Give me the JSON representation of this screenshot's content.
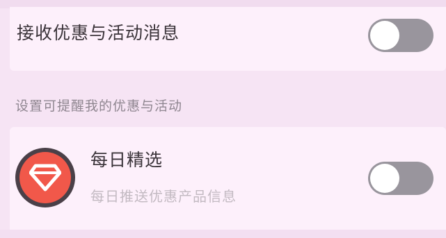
{
  "promo": {
    "receive_label": "接收优惠与活动消息",
    "receive_toggle": "off",
    "caption": "设置可提醒我的优惠与活动"
  },
  "daily_pick": {
    "title": "每日精选",
    "subtitle": "每日推送优惠产品信息",
    "icon": "diamond-icon",
    "toggle": "off"
  },
  "colors": {
    "background": "#f6e4f4",
    "card": "#fdf0fb",
    "toggle_off": "#99959d",
    "badge_accent": "#f1584a"
  }
}
